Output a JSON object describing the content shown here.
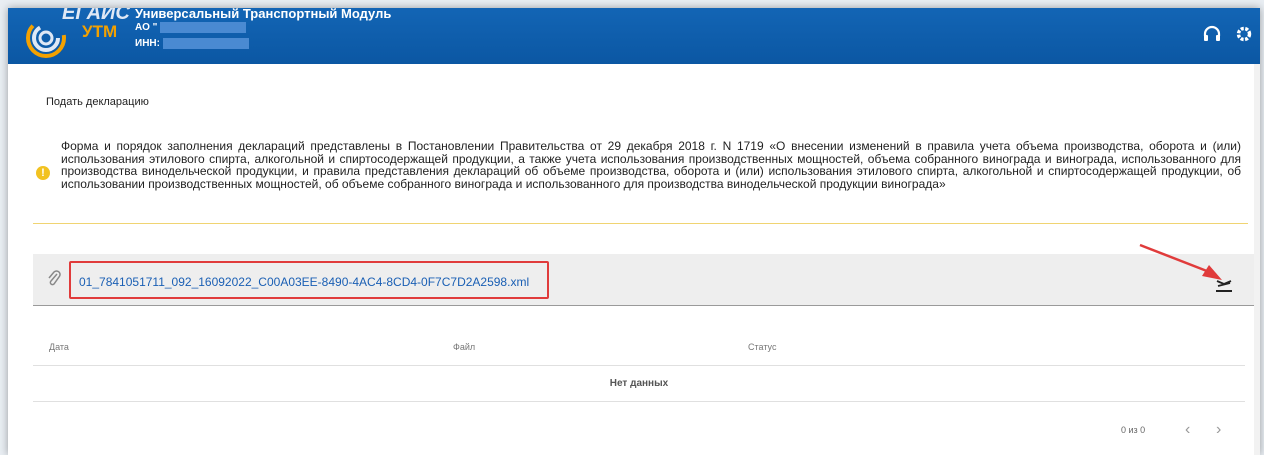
{
  "header": {
    "logo_egais": "ЕГАИС",
    "logo_utm": "УТМ",
    "app_title": "Универсальный Транспортный Модуль",
    "org_prefix": "АО \"",
    "inn_label": "ИНН:",
    "icons": [
      "headset-icon",
      "gear-icon",
      "logout-icon"
    ]
  },
  "page": {
    "title": "Подать декларацию",
    "notice_text": "Форма и порядок заполнения деклараций представлены в Постановлении Правительства от 29 декабря 2018 г. N 1719 «О внесении изменений в правила учета объема производства, оборота и (или) использования этилового спирта, алкогольной и спиртосодержащей продукции, а также учета использования производственных мощностей, объема собранного винограда и винограда, использованного для производства винодельческой продукции, и правила представления деклараций об объеме производства, оборота и (или) использования этилового спирта, алкогольной и спиртосодержащей продукции, об использовании производственных мощностей, об объеме собранного винограда и использованного для производства винодельческой продукции винограда»"
  },
  "file": {
    "name": "01_7841051711_092_16092022_C00A03EE-8490-4AC4-8CD4-0F7C7D2A2598.xml"
  },
  "table": {
    "columns": [
      "Дата",
      "Файл",
      "Статус"
    ],
    "empty_text": "Нет данных"
  },
  "pagination": {
    "label": "0 из 0",
    "prev": "‹",
    "next": "›"
  },
  "colors": {
    "header_bg": "#0d5aa7",
    "accent_orange": "#f4a100",
    "highlight_red": "#e03b3b",
    "link_blue": "#1a5fb4"
  }
}
